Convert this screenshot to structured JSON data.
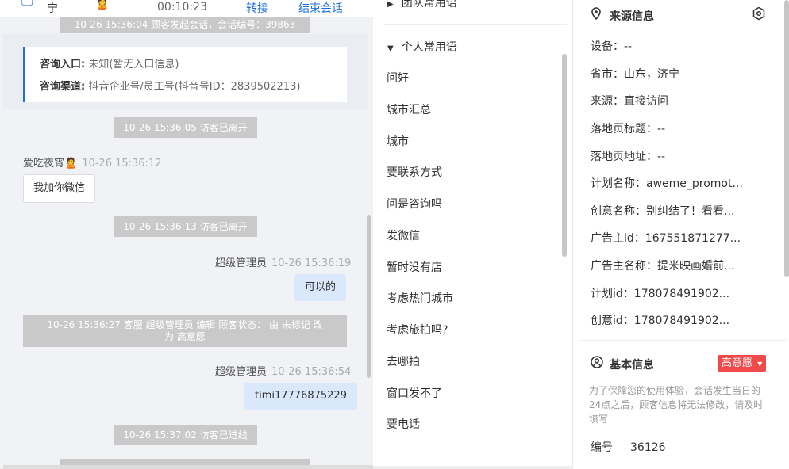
{
  "chat": {
    "header": {
      "location": "宁",
      "visitor_avatar": "🙎",
      "timer": "00:10:23",
      "transfer_label": "转接",
      "end_label": "结束会话"
    },
    "system_top": "10-26 15:36:04 顾客发起会话，会话编号：39863",
    "info_card": {
      "entry_label": "咨询入口:",
      "entry_value": "未知(暂无入口信息)",
      "channel_label": "咨询渠道:",
      "channel_value": "抖音企业号/员工号(抖音号ID：2839502213)"
    },
    "sys_leave_1": "10-26 15:36:05 访客已离开",
    "visitor_name": "爱吃夜宵🙎",
    "visitor_time": "10-26 15:36:12",
    "visitor_msg": "我加你微信",
    "sys_leave_2": "10-26 15:36:13 访客已离开",
    "agent_name": "超级管理员",
    "agent_time_1": "10-26 15:36:19",
    "agent_msg_1": "可以的",
    "sys_status_1": "10-26 15:36:27 客服 超级管理员 编辑 顾客状态： 由 未标记 改",
    "sys_status_2": "为 高意愿",
    "agent_time_2": "10-26 15:36:54",
    "agent_msg_2": "timi17776875229",
    "sys_enter": "10-26 15:37:02 访客已进线"
  },
  "phrases": {
    "team_label": "团队常用语",
    "personal_label": "个人常用语",
    "items": [
      "问好",
      "城市汇总",
      "城市",
      "要联系方式",
      "问是咨询吗",
      "发微信",
      "暂时没有店",
      "考虑热门城市",
      "考虑旅拍吗?",
      "去哪拍",
      "窗口发不了",
      "要电话"
    ]
  },
  "source": {
    "title": "来源信息",
    "fields": [
      {
        "label": "设备：",
        "value": "--"
      },
      {
        "label": "省市：",
        "value": "山东，济宁"
      },
      {
        "label": "来源：",
        "value": "直接访问"
      },
      {
        "label": "落地页标题：",
        "value": "--"
      },
      {
        "label": "落地页地址：",
        "value": "--"
      },
      {
        "label": "计划名称：",
        "value": "aweme_promot..."
      },
      {
        "label": "创意名称：",
        "value": "别纠结了！看看..."
      },
      {
        "label": "广告主id：",
        "value": "167551871277..."
      },
      {
        "label": "广告主名称：",
        "value": "提米映画婚前..."
      },
      {
        "label": "计划id：",
        "value": "178078491902..."
      },
      {
        "label": "创意id：",
        "value": "178078491902..."
      }
    ]
  },
  "basic": {
    "title": "基本信息",
    "tag": "高意愿",
    "note": "为了保障您的使用体验，会话发生当日的24点之后，顾客信息将无法修改，请及时填写",
    "number_label": "编号",
    "number_value": "36126"
  },
  "colors": {
    "accent": "#1f6fe0",
    "tag_red": "#f04949",
    "system_bubble": "#c9c9c9",
    "agent_bubble": "#d9e8fb"
  }
}
